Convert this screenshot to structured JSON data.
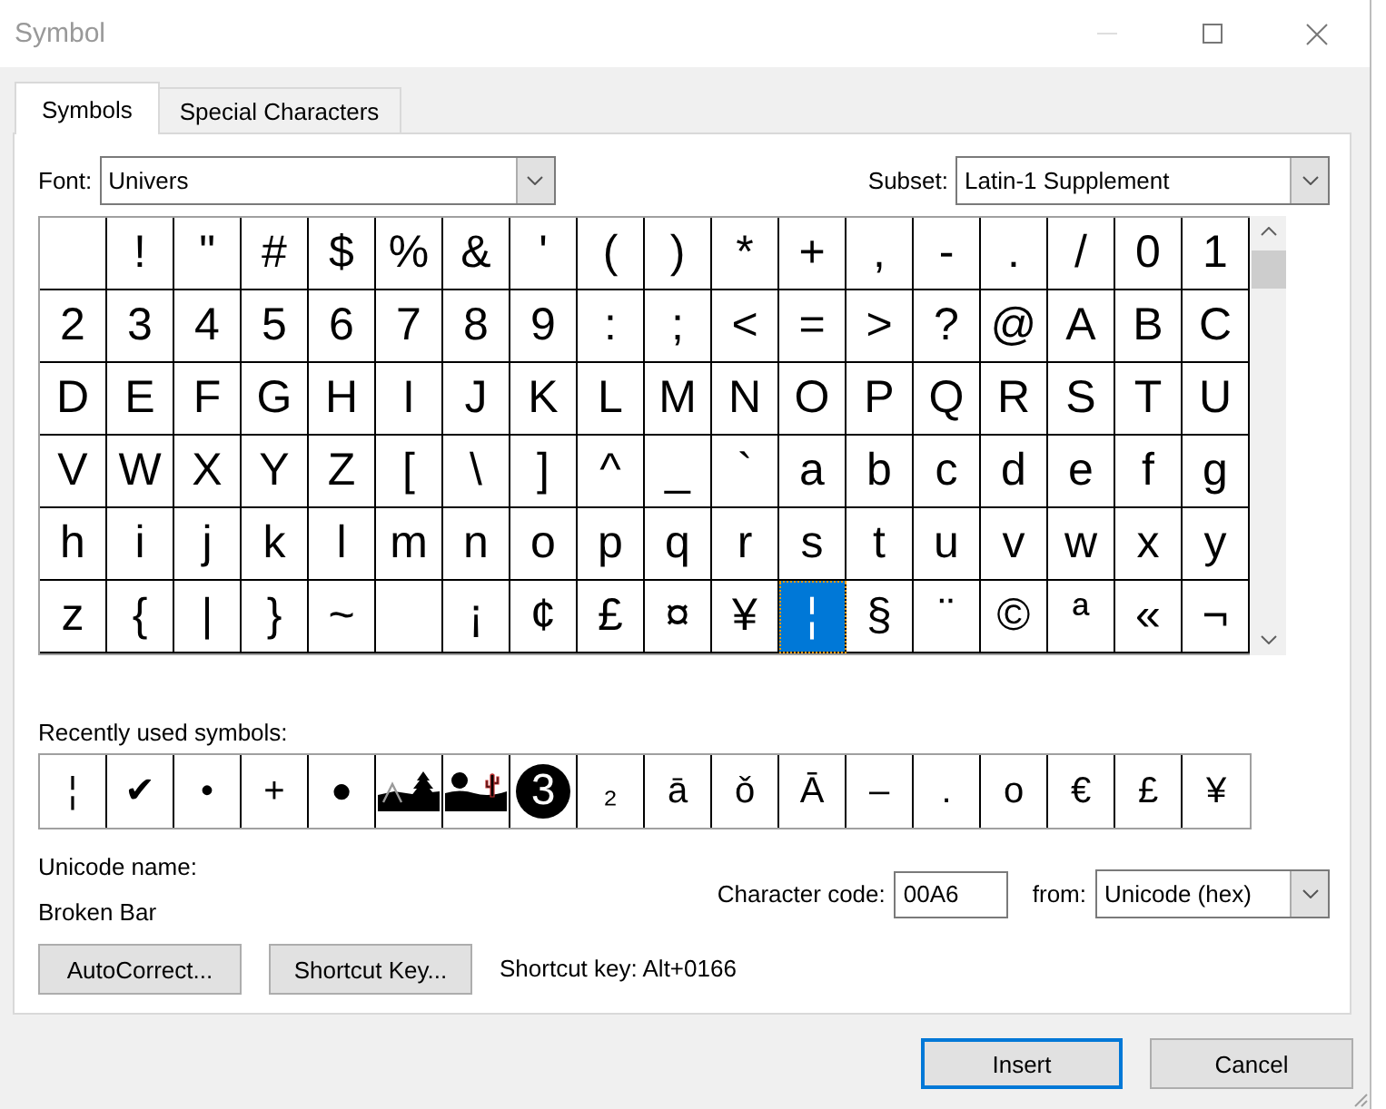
{
  "window": {
    "title": "Symbol",
    "minimize_disabled": true
  },
  "tabs": [
    {
      "label": "Symbols",
      "selected": true
    },
    {
      "label": "Special Characters",
      "selected": false
    }
  ],
  "font": {
    "label": "Font:",
    "value": "Univers"
  },
  "subset": {
    "label": "Subset:",
    "value": "Latin-1 Supplement"
  },
  "symbol_grid": {
    "rows": [
      [
        {
          "selected": false
        },
        {
          "char": "!",
          "selected": false
        },
        {
          "char": "\"",
          "selected": false
        },
        {
          "char": "#",
          "selected": false
        },
        {
          "char": "$",
          "selected": false
        },
        {
          "char": "%",
          "selected": false
        },
        {
          "char": "&",
          "selected": false
        },
        {
          "char": "'",
          "selected": false
        },
        {
          "char": "(",
          "selected": false
        },
        {
          "char": ")",
          "selected": false
        },
        {
          "char": "*",
          "selected": false
        },
        {
          "char": "+",
          "selected": false
        },
        {
          "char": ",",
          "selected": false
        },
        {
          "char": "-",
          "selected": false
        },
        {
          "char": ".",
          "selected": false
        },
        {
          "char": "/",
          "selected": false
        },
        {
          "char": "0",
          "selected": false
        },
        {
          "char": "1",
          "selected": false
        }
      ],
      [
        {
          "char": "2",
          "selected": false
        },
        {
          "char": "3",
          "selected": false
        },
        {
          "char": "4",
          "selected": false
        },
        {
          "char": "5",
          "selected": false
        },
        {
          "char": "6",
          "selected": false
        },
        {
          "char": "7",
          "selected": false
        },
        {
          "char": "8",
          "selected": false
        },
        {
          "char": "9",
          "selected": false
        },
        {
          "char": ":",
          "selected": false
        },
        {
          "char": ";",
          "selected": false
        },
        {
          "char": "<",
          "selected": false
        },
        {
          "char": "=",
          "selected": false
        },
        {
          "char": ">",
          "selected": false
        },
        {
          "char": "?",
          "selected": false
        },
        {
          "char": "@",
          "selected": false
        },
        {
          "char": "A",
          "selected": false
        },
        {
          "char": "B",
          "selected": false
        },
        {
          "char": "C",
          "selected": false
        }
      ],
      [
        {
          "char": "D",
          "selected": false
        },
        {
          "char": "E",
          "selected": false
        },
        {
          "char": "F",
          "selected": false
        },
        {
          "char": "G",
          "selected": false
        },
        {
          "char": "H",
          "selected": false
        },
        {
          "char": "I",
          "selected": false
        },
        {
          "char": "J",
          "selected": false
        },
        {
          "char": "K",
          "selected": false
        },
        {
          "char": "L",
          "selected": false
        },
        {
          "char": "M",
          "selected": false
        },
        {
          "char": "N",
          "selected": false
        },
        {
          "char": "O",
          "selected": false
        },
        {
          "char": "P",
          "selected": false
        },
        {
          "char": "Q",
          "selected": false
        },
        {
          "char": "R",
          "selected": false
        },
        {
          "char": "S",
          "selected": false
        },
        {
          "char": "T",
          "selected": false
        },
        {
          "char": "U",
          "selected": false
        }
      ],
      [
        {
          "char": "V",
          "selected": false
        },
        {
          "char": "W",
          "selected": false
        },
        {
          "char": "X",
          "selected": false
        },
        {
          "char": "Y",
          "selected": false
        },
        {
          "char": "Z",
          "selected": false
        },
        {
          "char": "[",
          "selected": false
        },
        {
          "char": "\\",
          "selected": false
        },
        {
          "char": "]",
          "selected": false
        },
        {
          "char": "^",
          "selected": false
        },
        {
          "char": "_",
          "selected": false
        },
        {
          "char": "`",
          "selected": false
        },
        {
          "char": "a",
          "selected": false
        },
        {
          "char": "b",
          "selected": false
        },
        {
          "char": "c",
          "selected": false
        },
        {
          "char": "d",
          "selected": false
        },
        {
          "char": "e",
          "selected": false
        },
        {
          "char": "f",
          "selected": false
        },
        {
          "char": "g",
          "selected": false
        }
      ],
      [
        {
          "char": "h",
          "selected": false
        },
        {
          "char": "i",
          "selected": false
        },
        {
          "char": "j",
          "selected": false
        },
        {
          "char": "k",
          "selected": false
        },
        {
          "char": "l",
          "selected": false
        },
        {
          "char": "m",
          "selected": false
        },
        {
          "char": "n",
          "selected": false
        },
        {
          "char": "o",
          "selected": false
        },
        {
          "char": "p",
          "selected": false
        },
        {
          "char": "q",
          "selected": false
        },
        {
          "char": "r",
          "selected": false
        },
        {
          "char": "s",
          "selected": false
        },
        {
          "char": "t",
          "selected": false
        },
        {
          "char": "u",
          "selected": false
        },
        {
          "char": "v",
          "selected": false
        },
        {
          "char": "w",
          "selected": false
        },
        {
          "char": "x",
          "selected": false
        },
        {
          "char": "y",
          "selected": false
        }
      ],
      [
        {
          "char": "z",
          "selected": false
        },
        {
          "char": "{",
          "selected": false
        },
        {
          "char": "|",
          "selected": false
        },
        {
          "char": "}",
          "selected": false
        },
        {
          "char": "~",
          "selected": false
        },
        {
          "selected": false
        },
        {
          "char": "¡",
          "selected": false
        },
        {
          "char": "¢",
          "selected": false
        },
        {
          "char": "£",
          "selected": false
        },
        {
          "char": "¤",
          "selected": false
        },
        {
          "char": "¥",
          "selected": false
        },
        {
          "char": "¦",
          "selected": true
        },
        {
          "char": "§",
          "selected": false
        },
        {
          "char": "¨",
          "selected": false
        },
        {
          "char": "©",
          "selected": false
        },
        {
          "char": "ª",
          "selected": false
        },
        {
          "char": "«",
          "selected": false
        },
        {
          "char": "¬",
          "selected": false
        }
      ]
    ]
  },
  "recent": {
    "label": "Recently used symbols:",
    "symbols": [
      {
        "kind": "char",
        "char": "¦"
      },
      {
        "kind": "char",
        "char": "✔"
      },
      {
        "kind": "char",
        "char": "•"
      },
      {
        "kind": "char",
        "char": "+"
      },
      {
        "kind": "char",
        "char": "●"
      },
      {
        "kind": "picture"
      },
      {
        "kind": "picture"
      },
      {
        "kind": "circled",
        "char": "3"
      },
      {
        "kind": "char",
        "char": "₂"
      },
      {
        "kind": "char",
        "char": "ā"
      },
      {
        "kind": "char",
        "char": "ǒ"
      },
      {
        "kind": "char",
        "char": "Ā"
      },
      {
        "kind": "char",
        "char": "–"
      },
      {
        "kind": "char",
        "char": "."
      },
      {
        "kind": "char",
        "char": "o"
      },
      {
        "kind": "char",
        "char": "€"
      },
      {
        "kind": "char",
        "char": "£"
      },
      {
        "kind": "char",
        "char": "¥"
      }
    ]
  },
  "unicode_name": {
    "label": "Unicode name:",
    "value": "Broken Bar"
  },
  "character_code": {
    "label": "Character code:",
    "value": "00A6"
  },
  "from": {
    "label": "from:",
    "value": "Unicode (hex)"
  },
  "autocorrect_button": {
    "label": "AutoCorrect..."
  },
  "shortcut_key_button": {
    "label": "Shortcut Key..."
  },
  "shortcut_info": "Shortcut key: Alt+0166",
  "dialog_buttons": [
    {
      "label": "Insert",
      "default": true
    },
    {
      "label": "Cancel",
      "default": false
    }
  ]
}
